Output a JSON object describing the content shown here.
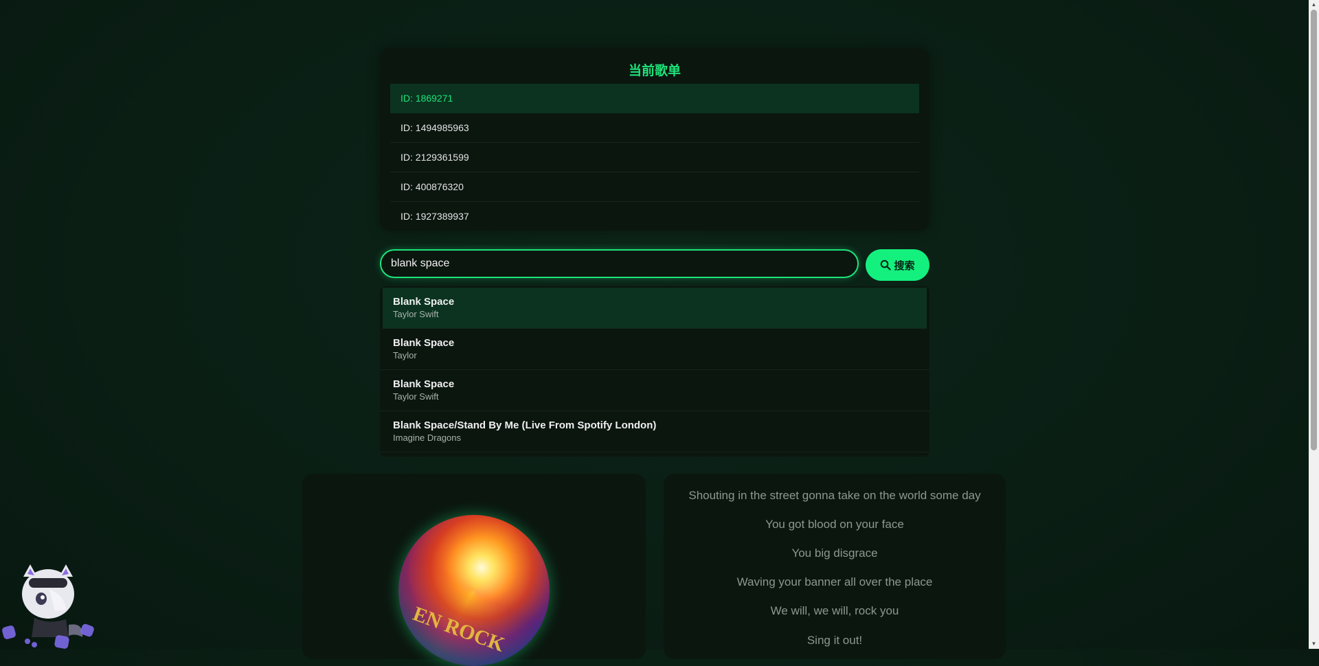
{
  "playlist": {
    "title": "当前歌单",
    "items": [
      {
        "label": "ID: 1869271"
      },
      {
        "label": "ID: 1494985963"
      },
      {
        "label": "ID: 2129361599"
      },
      {
        "label": "ID: 400876320"
      },
      {
        "label": "ID: 1927389937"
      }
    ]
  },
  "search": {
    "value": "blank space",
    "button_label": "搜索",
    "icon": "search-icon"
  },
  "results": [
    {
      "title": "Blank Space",
      "artist": "Taylor Swift"
    },
    {
      "title": "Blank Space",
      "artist": "Taylor"
    },
    {
      "title": "Blank Space",
      "artist": "Taylor Swift"
    },
    {
      "title": "Blank Space/Stand By Me (Live From Spotify London)",
      "artist": "Imagine Dragons"
    }
  ],
  "lyrics": [
    "Shouting in the street gonna take on the world some day",
    "You got blood on your face",
    "You big disgrace",
    "Waving your banner all over the place",
    "We will, we will, rock you",
    "Sing it out!"
  ],
  "colors": {
    "accent": "#1ee37a",
    "background": "#0a1e14",
    "card": "#0b160f",
    "active_row": "#0b3320"
  }
}
